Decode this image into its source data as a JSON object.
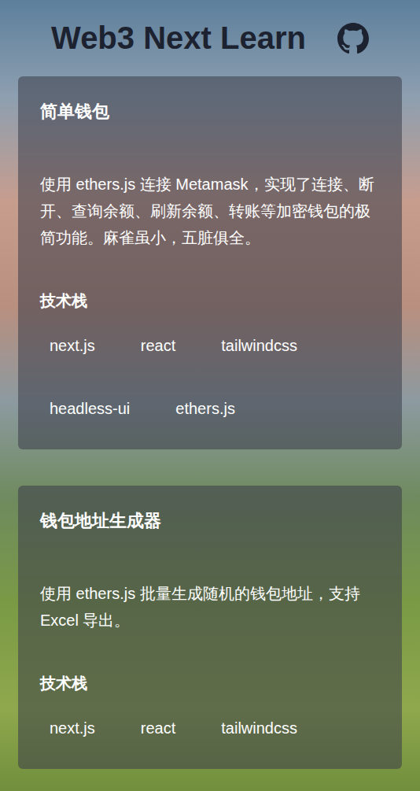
{
  "header": {
    "title": "Web3 Next Learn"
  },
  "cards": [
    {
      "title": "简单钱包",
      "description": "使用 ethers.js 连接 Metamask，实现了连接、断开、查询余额、刷新余额、转账等加密钱包的极简功能。麻雀虽小，五脏俱全。",
      "stack_label": "技术栈",
      "stack": [
        "next.js",
        "react",
        "tailwindcss",
        "headless-ui",
        "ethers.js"
      ]
    },
    {
      "title": "钱包地址生成器",
      "description": "使用 ethers.js 批量生成随机的钱包地址，支持 Excel 导出。",
      "stack_label": "技术栈",
      "stack": [
        "next.js",
        "react",
        "tailwindcss"
      ]
    }
  ]
}
